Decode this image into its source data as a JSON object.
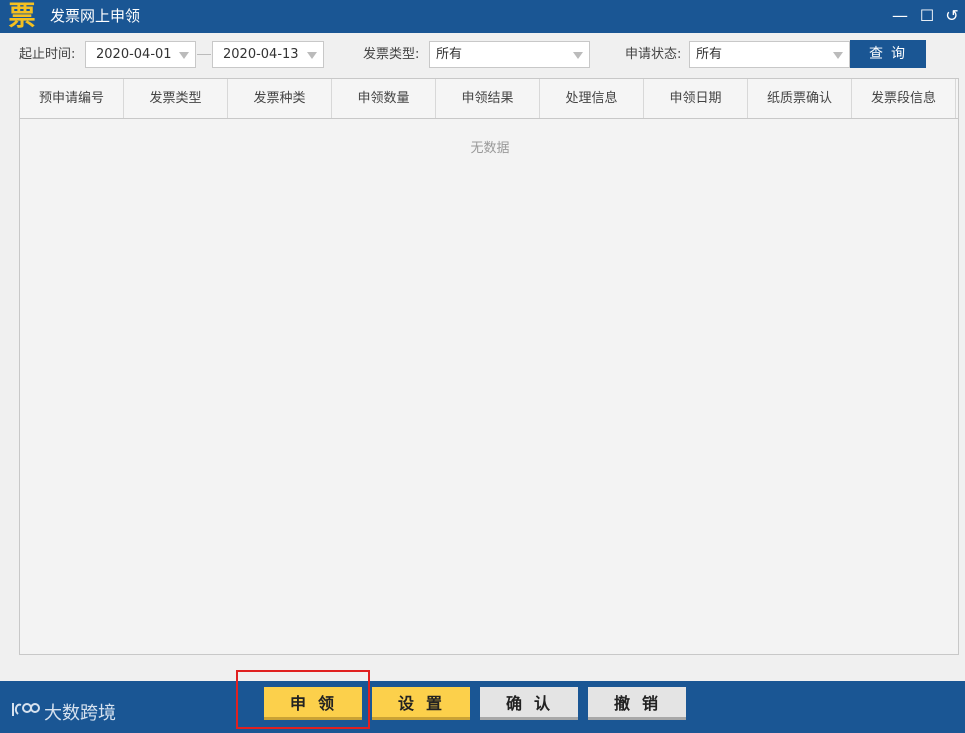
{
  "window": {
    "logo_char": "票",
    "title": "发票网上申领",
    "controls": {
      "minimize": "—",
      "maximize": "☐",
      "back": "↺"
    }
  },
  "filters": {
    "date_range_label": "起止时间:",
    "start_date": "2020-04-01",
    "end_date": "2020-04-13",
    "invoice_type_label": "发票类型:",
    "invoice_type_value": "所有",
    "apply_status_label": "申请状态:",
    "apply_status_value": "所有",
    "query_button": "查询"
  },
  "table": {
    "columns": [
      "预申请编号",
      "发票类型",
      "发票种类",
      "申领数量",
      "申领结果",
      "处理信息",
      "申领日期",
      "纸质票确认",
      "发票段信息"
    ],
    "rows": [],
    "empty_text": "无数据"
  },
  "footer": {
    "brand": "大数跨境",
    "buttons": {
      "apply": "申领",
      "settings": "设置",
      "confirm": "确认",
      "revoke": "撤销"
    }
  },
  "colors": {
    "primary": "#1a5694",
    "button_yellow": "#fcd04b",
    "button_gray": "#e4e4e4",
    "highlight": "#e02020"
  }
}
